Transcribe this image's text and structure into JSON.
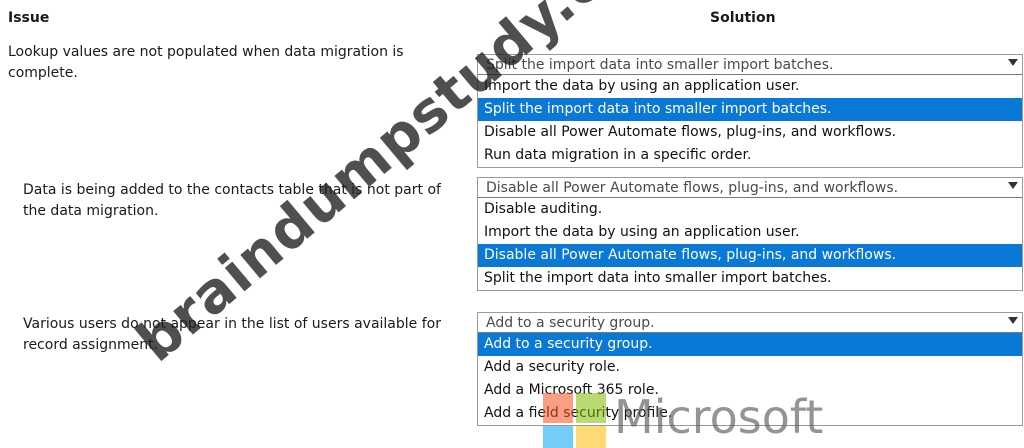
{
  "headers": {
    "issue": "Issue",
    "solution": "Solution"
  },
  "rows": [
    {
      "issue_lines": [
        "Lookup values are not populated when data migration is",
        "complete."
      ],
      "selected_value": "Split the import data into smaller import batches.",
      "options": [
        "Import the data by using an application user.",
        "Split the import data into smaller import batches.",
        "Disable all Power Automate flows, plug-ins, and workflows.",
        "Run data migration in a specific order."
      ],
      "highlighted_index": 1
    },
    {
      "issue_lines": [
        "Data is being added to the contacts table that is not part of",
        "the data migration."
      ],
      "selected_value": "Disable all Power Automate flows, plug-ins, and workflows.",
      "options": [
        "Disable auditing.",
        "Import the data by using an application user.",
        "Disable all Power Automate flows, plug-ins, and workflows.",
        "Split the import data into smaller import batches."
      ],
      "highlighted_index": 2
    },
    {
      "issue_lines": [
        "Various users do not appear in the list of users available for",
        "record assignment."
      ],
      "selected_value": "Add to a security group.",
      "options": [
        "Add to a security group.",
        "Add a security role.",
        "Add a Microsoft 365 role.",
        "Add a field security profile."
      ],
      "highlighted_index": 0
    }
  ],
  "watermark": {
    "text": "braindumpstudy.com"
  },
  "brand": {
    "name": "Microsoft",
    "colors": [
      "#f25022",
      "#7fba00",
      "#00a4ef",
      "#ffb900"
    ]
  },
  "colors": {
    "highlight": "#0a78d7"
  }
}
